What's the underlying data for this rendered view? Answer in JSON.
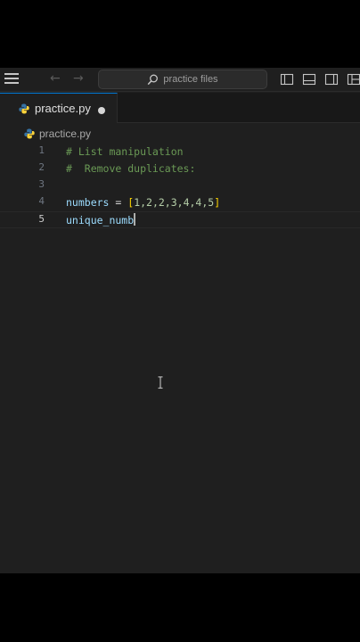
{
  "titlebar": {
    "search_label": "practice files",
    "icons": [
      "menu-icon",
      "back-arrow-icon",
      "forward-arrow-icon",
      "search-icon",
      "toggle-sidebar-icon",
      "toggle-panel-icon",
      "toggle-secondary-sidebar-icon",
      "customize-layout-icon"
    ]
  },
  "tab": {
    "label": "practice.py",
    "icon": "python-icon",
    "modified": true
  },
  "breadcrumb": {
    "file": "practice.py"
  },
  "editor": {
    "current_line": 5,
    "lines": [
      {
        "number": "1",
        "text": "# List manipulation"
      },
      {
        "number": "2",
        "text": "#  Remove duplicates:"
      },
      {
        "number": "3",
        "text": ""
      },
      {
        "number": "4",
        "var": "numbers",
        "op": " = ",
        "list_open": "[",
        "items": "1,2,2,3,4,4,5",
        "list_close": "]"
      },
      {
        "number": "5",
        "text": "unique_numb"
      }
    ]
  },
  "colors": {
    "accent": "#0078d4",
    "editor_bg": "#1f1f1f",
    "comment": "#6a9955",
    "variable": "#9cdcfe",
    "number": "#b5cea8",
    "bracket": "#ffd700",
    "python_blue": "#3572a5",
    "python_yellow": "#ffd43b"
  }
}
